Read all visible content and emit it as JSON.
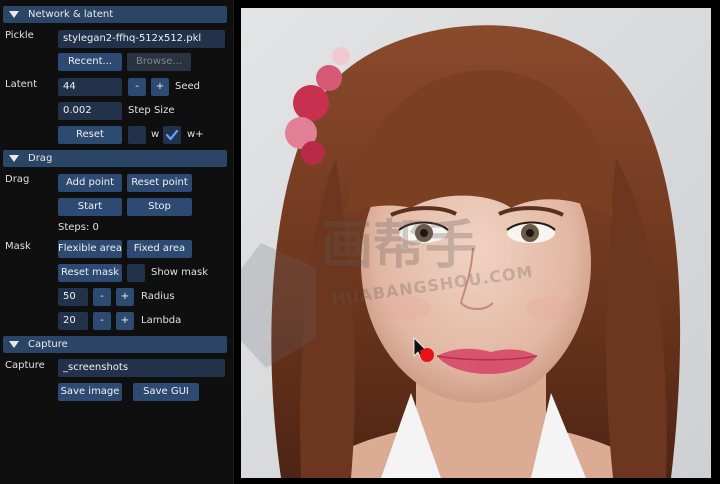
{
  "sections": {
    "network": "Network & latent",
    "drag": "Drag",
    "capture": "Capture"
  },
  "network": {
    "pickle_label": "Pickle",
    "pickle_value": "stylegan2-ffhq-512x512.pkl",
    "recent_label": "Recent...",
    "browse_label": "Browse...",
    "latent_label": "Latent",
    "seed_value": "44",
    "minus": "-",
    "plus": "+",
    "seed_label": "Seed",
    "step_size_value": "0.002",
    "step_size_label": "Step Size",
    "reset_label": "Reset",
    "w_label": "w",
    "wplus_label": "w+",
    "w_checked": false,
    "wplus_checked": true
  },
  "drag": {
    "drag_label": "Drag",
    "add_point": "Add point",
    "reset_point": "Reset point",
    "start": "Start",
    "stop": "Stop",
    "steps": "Steps: 0",
    "mask_label": "Mask",
    "flexible_area": "Flexible area",
    "fixed_area": "Fixed area",
    "reset_mask": "Reset mask",
    "show_mask": "Show mask",
    "show_mask_checked": false,
    "radius_value": "50",
    "radius_label": "Radius",
    "lambda_value": "20",
    "lambda_label": "Lambda",
    "minus": "-",
    "plus": "+"
  },
  "capture": {
    "capture_label": "Capture",
    "path_value": "_screenshots",
    "save_image": "Save image",
    "save_gui": "Save GUI"
  },
  "viewer": {
    "watermark_text": "HUABANGSHOU.COM",
    "watermark_cn": "画帮手"
  },
  "colors": {
    "header": "#2b4566",
    "button": "#2c4a72",
    "field": "#22324a",
    "handle_point": "#e8121b"
  }
}
